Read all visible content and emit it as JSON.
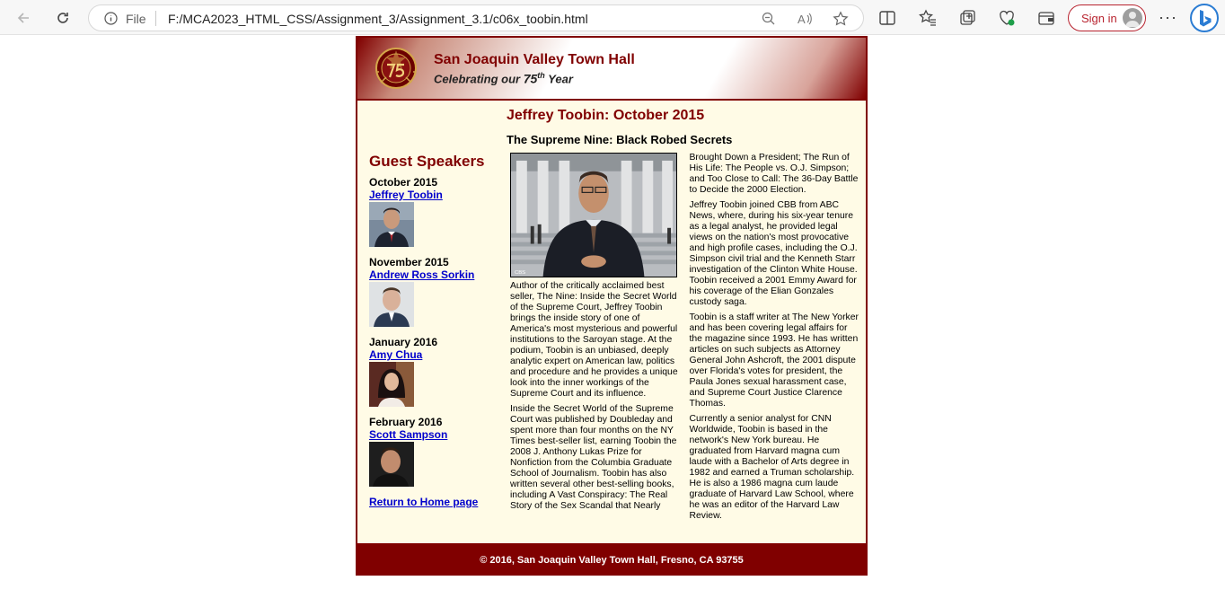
{
  "browser": {
    "url_scheme": "File",
    "url": "F:/MCA2023_HTML_CSS/Assignment_3/Assignment_3.1/c06x_toobin.html",
    "sign_in_label": "Sign in",
    "more_label": "···"
  },
  "header": {
    "title": "San Joaquin Valley Town Hall",
    "subtitle_prefix": "Celebrating our",
    "subtitle_number": "75",
    "subtitle_suffix_sup": "th",
    "subtitle_suffix": "Year"
  },
  "sidebar": {
    "heading": "Guest Speakers",
    "speakers": [
      {
        "date": "October 2015",
        "name": "Jeffrey Toobin"
      },
      {
        "date": "November 2015",
        "name": "Andrew Ross Sorkin"
      },
      {
        "date": "January 2016",
        "name": "Amy Chua"
      },
      {
        "date": "February 2016",
        "name": "Scott Sampson"
      }
    ],
    "home_link": "Return to Home page"
  },
  "main": {
    "title": "Jeffrey Toobin: October 2015",
    "subtitle": "The Supreme Nine: Black Robed Secrets",
    "paragraphs": [
      "Author of the critically acclaimed best seller, The Nine: Inside the Secret World of the Supreme Court, Jeffrey Toobin brings the inside story of one of America's most mysterious and powerful institutions to the Saroyan stage. At the podium, Toobin is an unbiased, deeply analytic expert on American law, politics and procedure and he provides a unique look into the inner workings of the Supreme Court and its influence.",
      "Inside the Secret World of the Supreme Court was published by Doubleday and spent more than four months on the NY Times best-seller list, earning Toobin the 2008 J. Anthony Lukas Prize for Nonfiction from the Columbia Graduate School of Journalism. Toobin has also written several other best-selling books, including A Vast Conspiracy: The Real Story of the Sex Scandal that Nearly Brought Down a President; The Run of His Life: The People vs. O.J. Simpson; and Too Close to Call: The 36-Day Battle to Decide the 2000 Election.",
      "Jeffrey Toobin joined CBB from ABC News, where, during his six-year tenure as a legal analyst, he provided legal views on the nation's most provocative and high profile cases, including the O.J. Simpson civil trial and the Kenneth Starr investigation of the Clinton White House. Toobin received a 2001 Emmy Award for his coverage of the Elian Gonzales custody saga.",
      "Toobin is a staff writer at The New Yorker and has been covering legal affairs for the magazine since 1993. He has written articles on such subjects as Attorney General John Ashcroft, the 2001 dispute over Florida's votes for president, the Paula Jones sexual harassment case, and Supreme Court Justice Clarence Thomas.",
      "Currently a senior analyst for CNN Worldwide, Toobin is based in the network's New York bureau. He graduated from Harvard magna cum laude with a Bachelor of Arts degree in 1982 and earned a Truman scholarship. He is also a 1986 magna cum laude graduate of Harvard Law School, where he was an editor of the Harvard Law Review."
    ]
  },
  "footer": {
    "text": "© 2016, San Joaquin Valley Town Hall, Fresno, CA 93755"
  },
  "colors": {
    "brand": "#800000",
    "background": "#fffbe6",
    "link": "#0000cc"
  }
}
